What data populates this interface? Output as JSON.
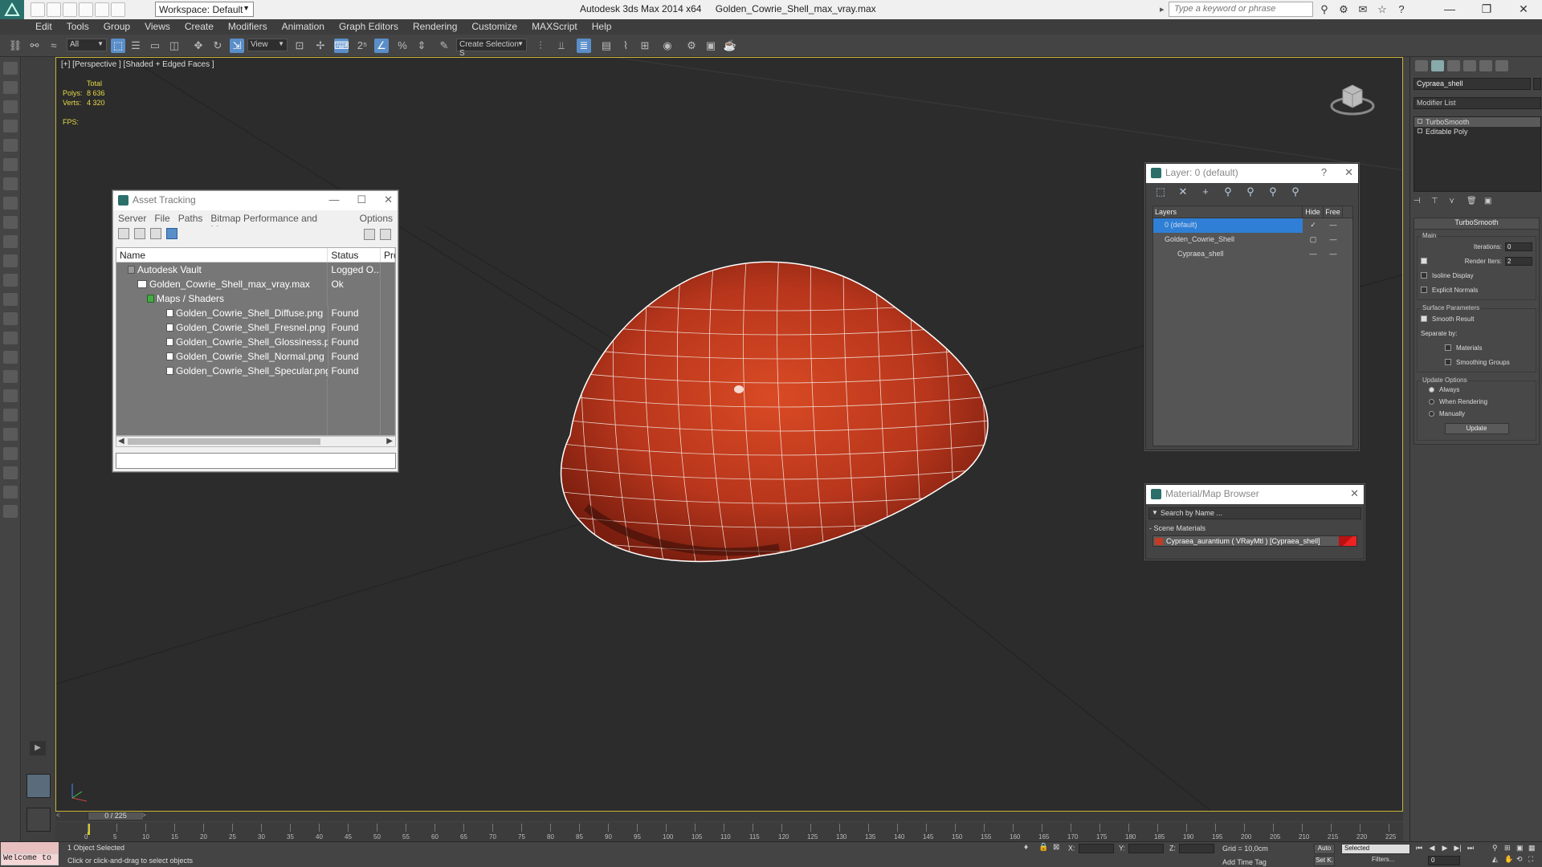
{
  "titlebar": {
    "workspace": "Workspace: Default",
    "app": "Autodesk 3ds Max  2014 x64",
    "file": "Golden_Cowrie_Shell_max_vray.max",
    "search_placeholder": "Type a keyword or phrase"
  },
  "menu": [
    "Edit",
    "Tools",
    "Group",
    "Views",
    "Create",
    "Modifiers",
    "Animation",
    "Graph Editors",
    "Rendering",
    "Customize",
    "MAXScript",
    "Help"
  ],
  "toolbar": {
    "selection_filter": "All",
    "ref_coord": "View",
    "named_selection": "Create Selection S"
  },
  "viewport": {
    "label": "[+] [Perspective ] [Shaded + Edged Faces ]",
    "stats_header": "Total",
    "polys_label": "Polys:",
    "polys_value": "8 636",
    "verts_label": "Verts:",
    "verts_value": "4 320",
    "fps_label": "FPS:"
  },
  "asset_tracking": {
    "title": "Asset Tracking",
    "menu": [
      "Server",
      "File",
      "Paths",
      "Bitmap Performance and Memory",
      "Options"
    ],
    "columns": [
      "Name",
      "Status",
      "Pro"
    ],
    "rows": [
      {
        "name": "Autodesk Vault",
        "status": "Logged O...",
        "indent": 1
      },
      {
        "name": "Golden_Cowrie_Shell_max_vray.max",
        "status": "Ok",
        "indent": 2
      },
      {
        "name": "Maps / Shaders",
        "status": "",
        "indent": 3
      },
      {
        "name": "Golden_Cowrie_Shell_Diffuse.png",
        "status": "Found",
        "indent": 4
      },
      {
        "name": "Golden_Cowrie_Shell_Fresnel.png",
        "status": "Found",
        "indent": 4
      },
      {
        "name": "Golden_Cowrie_Shell_Glossiness.png",
        "status": "Found",
        "indent": 4
      },
      {
        "name": "Golden_Cowrie_Shell_Normal.png",
        "status": "Found",
        "indent": 4
      },
      {
        "name": "Golden_Cowrie_Shell_Specular.png",
        "status": "Found",
        "indent": 4
      }
    ]
  },
  "layer_panel": {
    "title": "Layer: 0 (default)",
    "help": "?",
    "columns": [
      "Layers",
      "Hide",
      "Free"
    ],
    "rows": [
      {
        "name": "0 (default)",
        "selected": true
      },
      {
        "name": "Golden_Cowrie_Shell",
        "selected": false
      },
      {
        "name": "Cypraea_shell",
        "selected": false
      }
    ]
  },
  "material_browser": {
    "title": "Material/Map Browser",
    "search": "Search by Name ...",
    "section": "- Scene Materials",
    "item": "Cypraea_aurantium  ( VRayMtl ) [Cypraea_shell]"
  },
  "command_panel": {
    "object_name": "Cypraea_shell",
    "modifier_list": "Modifier List",
    "stack": [
      "TurboSmooth",
      "Editable Poly"
    ],
    "turbosmooth": {
      "title": "TurboSmooth",
      "main": "Main",
      "iterations_label": "Iterations:",
      "iterations": "0",
      "render_iters_label": "Render Iters:",
      "render_iters": "2",
      "isoline": "Isoline Display",
      "explicit": "Explicit Normals",
      "surface": "Surface Parameters",
      "smooth_result": "Smooth Result",
      "separate_by": "Separate by:",
      "materials": "Materials",
      "smoothing_groups": "Smoothing Groups",
      "update_options": "Update Options",
      "always": "Always",
      "when_rendering": "When Rendering",
      "manually": "Manually",
      "update": "Update"
    }
  },
  "timeline": {
    "frame": "0 / 225",
    "ticks": [
      "0",
      "5",
      "10",
      "15",
      "20",
      "25",
      "30",
      "35",
      "40",
      "45",
      "50",
      "55",
      "60",
      "65",
      "70",
      "75",
      "80",
      "85",
      "90",
      "95",
      "100",
      "105",
      "110",
      "115",
      "120",
      "125",
      "130",
      "135",
      "140",
      "145",
      "150",
      "155",
      "160",
      "165",
      "170",
      "175",
      "180",
      "185",
      "190",
      "195",
      "200",
      "205",
      "210",
      "215",
      "220",
      "225"
    ]
  },
  "status": {
    "welcome": "Welcome to",
    "selected": "1 Object Selected",
    "hint": "Click or click-and-drag to select objects",
    "x_label": "X:",
    "y_label": "Y:",
    "z_label": "Z:",
    "grid": "Grid = 10,0cm",
    "add_time_tag": "Add Time Tag",
    "auto": "Auto",
    "set_key": "Set K.",
    "selected_drop": "Selected",
    "filters": "Filters...",
    "frame": "0"
  },
  "colors": {
    "shell": "#b8361c",
    "viewport_border": "#c8b43a",
    "selection_blue": "#2f7fd6"
  }
}
